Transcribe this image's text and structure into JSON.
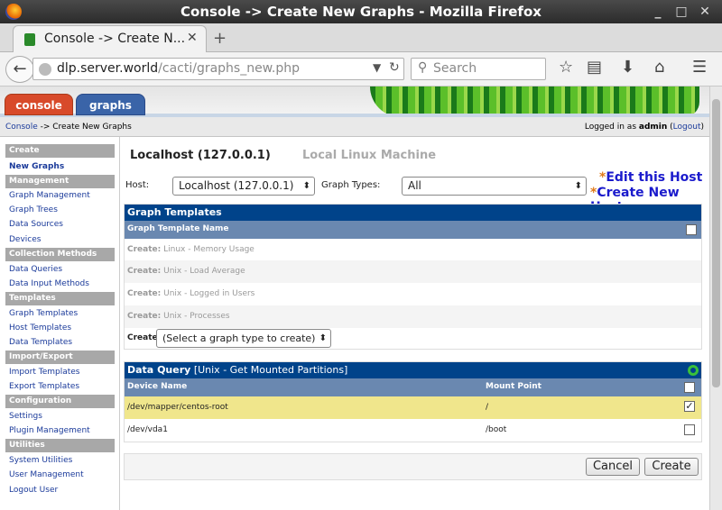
{
  "window": {
    "title": "Console -> Create New Graphs - Mozilla Firefox",
    "min": "_",
    "max": "□",
    "close": "✕"
  },
  "browser": {
    "tab_title": "Console -> Create N...",
    "url_host": "dlp.server.world",
    "url_path": "/cacti/graphs_new.php",
    "search_placeholder": "Search"
  },
  "cacti": {
    "tabs": {
      "console": "console",
      "graphs": "graphs"
    },
    "breadcrumb": {
      "link": "Console",
      "rest": "-> Create New Graphs"
    },
    "login": {
      "prefix": "Logged in as",
      "user": "admin",
      "logout": "Logout"
    },
    "sidebar": {
      "create_header": "Create",
      "new_graphs": "New Graphs",
      "management_header": "Management",
      "management": [
        "Graph Management",
        "Graph Trees",
        "Data Sources",
        "Devices"
      ],
      "collection_header": "Collection Methods",
      "collection": [
        "Data Queries",
        "Data Input Methods"
      ],
      "templates_header": "Templates",
      "templates": [
        "Graph Templates",
        "Host Templates",
        "Data Templates"
      ],
      "importexport_header": "Import/Export",
      "importexport": [
        "Import Templates",
        "Export Templates"
      ],
      "configuration_header": "Configuration",
      "configuration": [
        "Settings",
        "Plugin Management"
      ],
      "utilities_header": "Utilities",
      "utilities": [
        "System Utilities",
        "User Management",
        "Logout User"
      ]
    },
    "main": {
      "host_title": "Localhost (127.0.0.1)",
      "host_desc": "Local Linux Machine",
      "host_label": "Host:",
      "host_value": "Localhost (127.0.0.1)",
      "graph_types_label": "Graph Types:",
      "graph_types_value": "All",
      "edit_host": "Edit this Host",
      "create_host": "Create New Host",
      "graph_templates_header": "Graph Templates",
      "graph_template_name_col": "Graph Template Name",
      "create_prefix": "Create:",
      "templates": [
        "Linux - Memory Usage",
        "Unix - Load Average",
        "Unix - Logged in Users",
        "Unix - Processes"
      ],
      "create_select_label": "Create:",
      "create_select_value": "(Select a graph type to create)",
      "data_query_label": "Data Query",
      "data_query_name": "[Unix - Get Mounted Partitions]",
      "device_name_col": "Device Name",
      "mount_point_col": "Mount Point",
      "rows": [
        {
          "device": "/dev/mapper/centos-root",
          "mount": "/",
          "checked": true
        },
        {
          "device": "/dev/vda1",
          "mount": "/boot",
          "checked": false
        }
      ],
      "cancel": "Cancel",
      "create": "Create"
    }
  }
}
